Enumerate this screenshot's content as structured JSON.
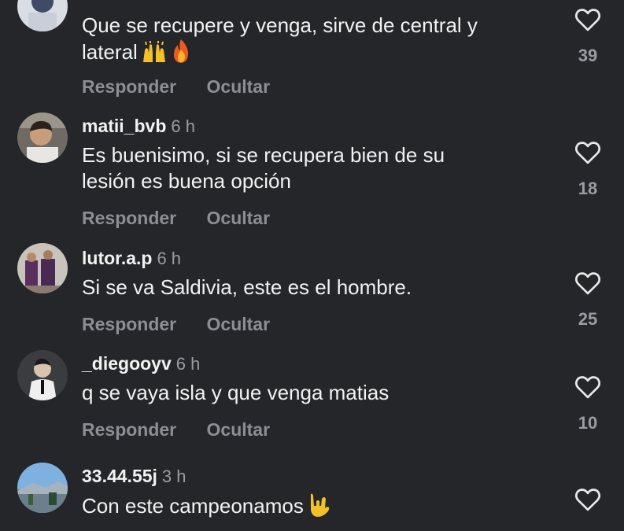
{
  "comments": [
    {
      "username": "",
      "time": "",
      "text_lines": [
        "Que se recupere y venga, sirve de central y",
        "lateral"
      ],
      "emojis": [
        "raising-hands",
        "fire"
      ],
      "reply_label": "Responder",
      "hide_label": "Ocultar",
      "likes": "39"
    },
    {
      "username": "matii_bvb",
      "time": "6 h",
      "text_lines": [
        "Es buenisimo, si se recupera bien de su",
        "lesión es buena opción"
      ],
      "reply_label": "Responder",
      "hide_label": "Ocultar",
      "likes": "18"
    },
    {
      "username": "lutor.a.p",
      "time": "6 h",
      "text_lines": [
        "Si se va Saldivia, este es el hombre."
      ],
      "reply_label": "Responder",
      "hide_label": "Ocultar",
      "likes": "25"
    },
    {
      "username": "_diegooyv",
      "time": "6 h",
      "text_lines": [
        "q se vaya isla y que venga matias"
      ],
      "reply_label": "Responder",
      "hide_label": "Ocultar",
      "likes": "10"
    },
    {
      "username": "33.44.55j",
      "time": "3 h",
      "text_lines": [
        "Con este campeonamos"
      ],
      "emojis": [
        "rock-hand"
      ],
      "likes": ""
    }
  ],
  "icons": {
    "like": "heart-outline-icon"
  },
  "colors": {
    "background": "#24262a",
    "muted": "#8c8e94",
    "text": "#f2f2f2"
  }
}
